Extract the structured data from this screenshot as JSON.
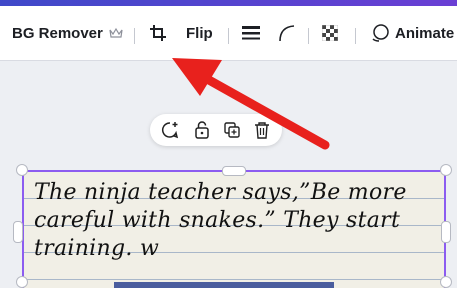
{
  "toolbar": {
    "bg_remover_label": "BG Remover",
    "flip_label": "Flip",
    "animate_label": "Animate"
  },
  "icons": {
    "crown": "crown-icon",
    "crop": "crop-icon",
    "line_weight": "line-weight-icon",
    "corner": "corner-rounding-icon",
    "transparency": "transparency-icon",
    "animate": "animate-icon",
    "comment": "add-comment-icon",
    "lock": "lock-icon",
    "duplicate": "duplicate-icon",
    "delete": "delete-icon"
  },
  "canvas": {
    "handwriting_lines": [
      "The ninja teacher says,”Be more",
      "careful with snakes.” They start",
      "training. w"
    ]
  },
  "colors": {
    "selection": "#8c5cf0",
    "arrow": "#e8211d",
    "top_strip": "#3f49c9"
  }
}
